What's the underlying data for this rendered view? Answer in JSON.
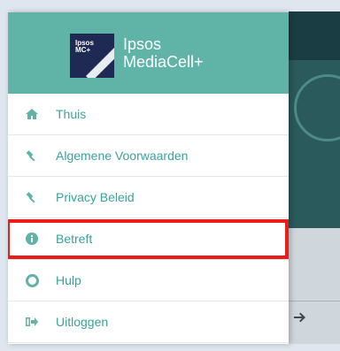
{
  "app": {
    "brand_line1": "Ipsos",
    "brand_line2": "MediaCell+",
    "logo_line1": "Ipsos",
    "logo_line2": "MC+"
  },
  "menu": {
    "items": [
      {
        "label": "Thuis",
        "icon": "home-icon"
      },
      {
        "label": "Algemene Voorwaarden",
        "icon": "gavel-icon"
      },
      {
        "label": "Privacy Beleid",
        "icon": "gavel-icon"
      },
      {
        "label": "Betreft",
        "icon": "info-circle-icon",
        "selected": true
      },
      {
        "label": "Hulp",
        "icon": "life-ring-icon"
      },
      {
        "label": "Uitloggen",
        "icon": "sign-out-icon"
      }
    ]
  },
  "colors": {
    "header": "#5fb3a7",
    "accent": "#3aa39a",
    "highlight": "#ee1b1b",
    "logo_bg": "#1f2a54"
  }
}
